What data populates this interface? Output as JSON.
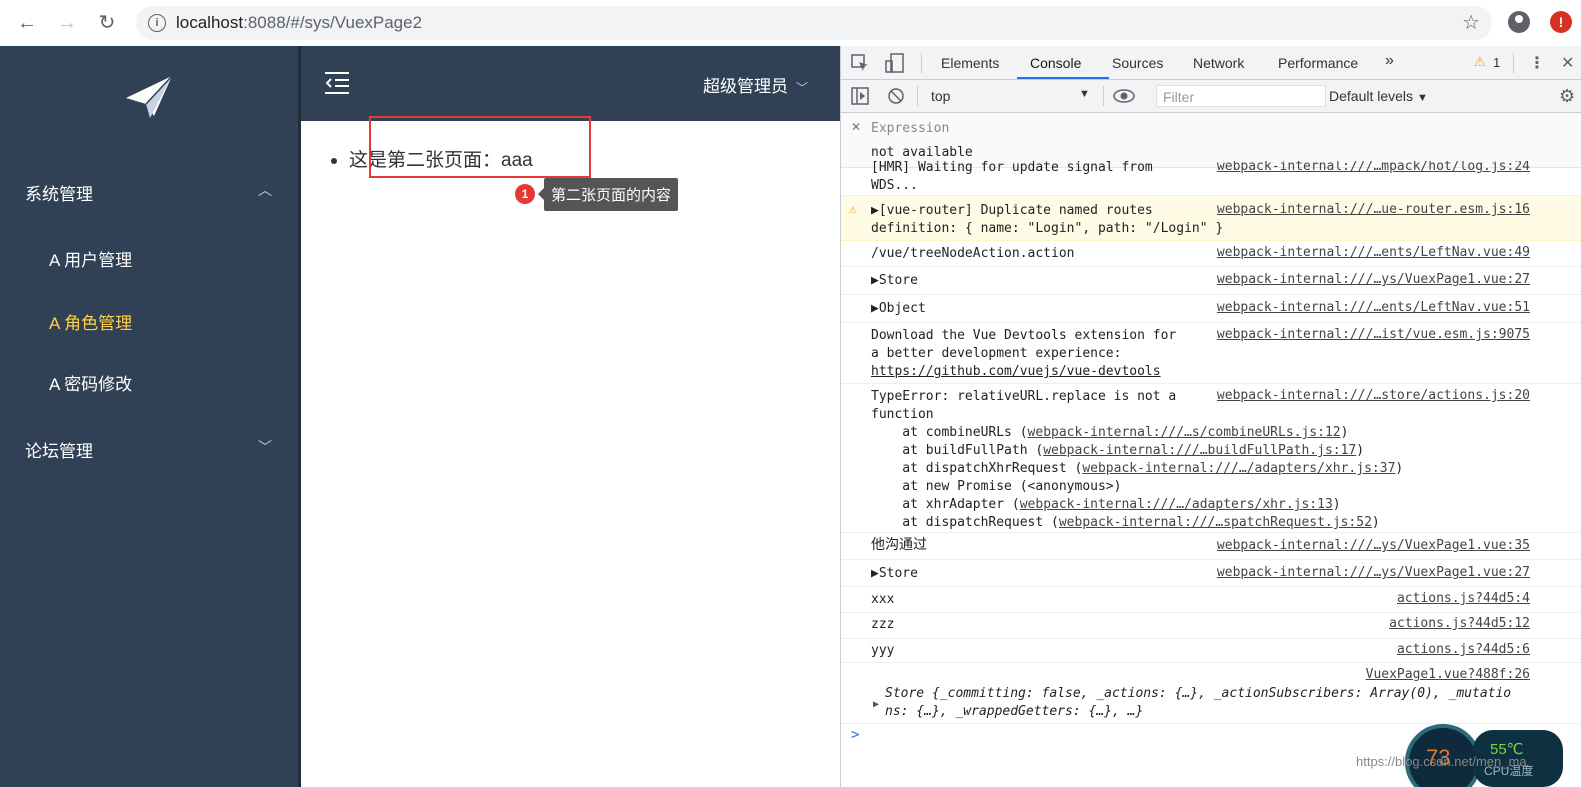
{
  "browser": {
    "url_host": "localhost",
    "url_path": ":8088/#/sys/VuexPage2"
  },
  "sidebar": {
    "groups": [
      {
        "label": "系统管理",
        "items": [
          {
            "label": "A 用户管理",
            "active": false
          },
          {
            "label": "A 角色管理",
            "active": true
          },
          {
            "label": "A 密码修改",
            "active": false
          }
        ]
      },
      {
        "label": "论坛管理"
      }
    ],
    "active_color": "#ffd04b",
    "bg_color": "#304156"
  },
  "header": {
    "user": "超级管理员"
  },
  "content": {
    "bullet_text": "这是第二张页面：aaa",
    "annotation_number": "1",
    "annotation_text": "第二张页面的内容"
  },
  "devtools": {
    "tabs": [
      "Elements",
      "Console",
      "Sources",
      "Network",
      "Performance"
    ],
    "active_tab": "Console",
    "more_tabs": "»",
    "warning_count": "1",
    "context": "top",
    "filter_placeholder": "Filter",
    "levels": "Default levels",
    "expression": {
      "label": "Expression",
      "value": "not available"
    },
    "logs": [
      {
        "msg": "[HMR] Waiting for update signal from\nWDS...",
        "src": "webpack-internal:///…mpack/hot/log.js:24"
      },
      {
        "msg": "▶[vue-router] Duplicate named routes\ndefinition: { name: \"Login\", path: \"/Login\" }",
        "src": "webpack-internal:///…ue-router.esm.js:16",
        "warn": true
      },
      {
        "msg": "/vue/treeNodeAction.action",
        "src": "webpack-internal:///…ents/LeftNav.vue:49"
      },
      {
        "msg": "▶Store",
        "src": "webpack-internal:///…ys/VuexPage1.vue:27"
      },
      {
        "msg": "▶Object",
        "src": "webpack-internal:///…ents/LeftNav.vue:51"
      },
      {
        "msg": "Download the Vue Devtools extension for\na better development experience:",
        "link": "https://github.com/vuejs/vue-devtools",
        "src": "webpack-internal:///…ist/vue.esm.js:9075"
      },
      {
        "msg": "TypeError: relativeURL.replace is not a\nfunction",
        "src": "webpack-internal:///…store/actions.js:20",
        "stack": [
          {
            "pre": "    at combineURLs (",
            "link": "webpack-internal:///…s/combineURLs.js:12",
            "post": ")"
          },
          {
            "pre": "    at buildFullPath (",
            "link": "webpack-internal:///…buildFullPath.js:17",
            "post": ")"
          },
          {
            "pre": "    at dispatchXhrRequest (",
            "link": "webpack-internal:///…/adapters/xhr.js:37",
            "post": ")"
          },
          {
            "pre": "    at new Promise (<anonymous>)",
            "link": "",
            "post": ""
          },
          {
            "pre": "    at xhrAdapter (",
            "link": "webpack-internal:///…/adapters/xhr.js:13",
            "post": ")"
          },
          {
            "pre": "    at dispatchRequest (",
            "link": "webpack-internal:///…spatchRequest.js:52",
            "post": ")"
          }
        ]
      },
      {
        "msg": "他沟通过",
        "src": "webpack-internal:///…ys/VuexPage1.vue:35"
      },
      {
        "msg": "▶Store",
        "src": "webpack-internal:///…ys/VuexPage1.vue:27"
      },
      {
        "msg": "xxx",
        "src": "actions.js?44d5:4"
      },
      {
        "msg": "zzz",
        "src": "actions.js?44d5:12"
      },
      {
        "msg": "yyy",
        "src": "actions.js?44d5:6"
      },
      {
        "msg": "Store {_committing: false, _actions: {…}, _actionSubscribers: Array(0), _mutatio\nns: {…}, _wrappedGetters: {…}, …}",
        "src": "VuexPage1.vue?488f:26"
      }
    ],
    "prompt": ">"
  },
  "overlay": {
    "temp_left": "73",
    "temp_right": "55℃",
    "cpu_label": "CPU温度",
    "watermark": "https://blog.csdn.net/men_ma"
  }
}
